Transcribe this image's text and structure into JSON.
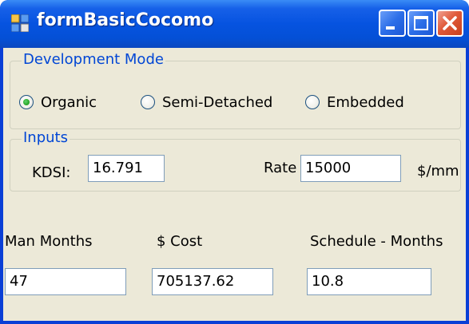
{
  "window": {
    "title": "formBasicCocomo",
    "icon": "form-app-icon",
    "buttons": [
      "minimize-icon",
      "maximize-icon",
      "close-icon"
    ]
  },
  "development_mode": {
    "legend": "Development Mode",
    "options": [
      {
        "label": "Organic",
        "selected": true
      },
      {
        "label": "Semi-Detached",
        "selected": false
      },
      {
        "label": "Embedded",
        "selected": false
      }
    ]
  },
  "inputs": {
    "legend": "Inputs",
    "kdsi_label": "KDSI:",
    "kdsi_value": "16.791",
    "rate_label": "Rate",
    "rate_value": "15000",
    "rate_unit": "$/mm"
  },
  "outputs": {
    "man_months_label": "Man Months",
    "man_months_value": "47",
    "cost_label": "$ Cost",
    "cost_value": "705137.62",
    "schedule_label": "Schedule - Months",
    "schedule_value": "10.8"
  },
  "colors": {
    "title_bar": "#0653e0",
    "client_background": "#ece9d8",
    "group_legend": "#0046d5",
    "close_button": "#e05a3a"
  }
}
